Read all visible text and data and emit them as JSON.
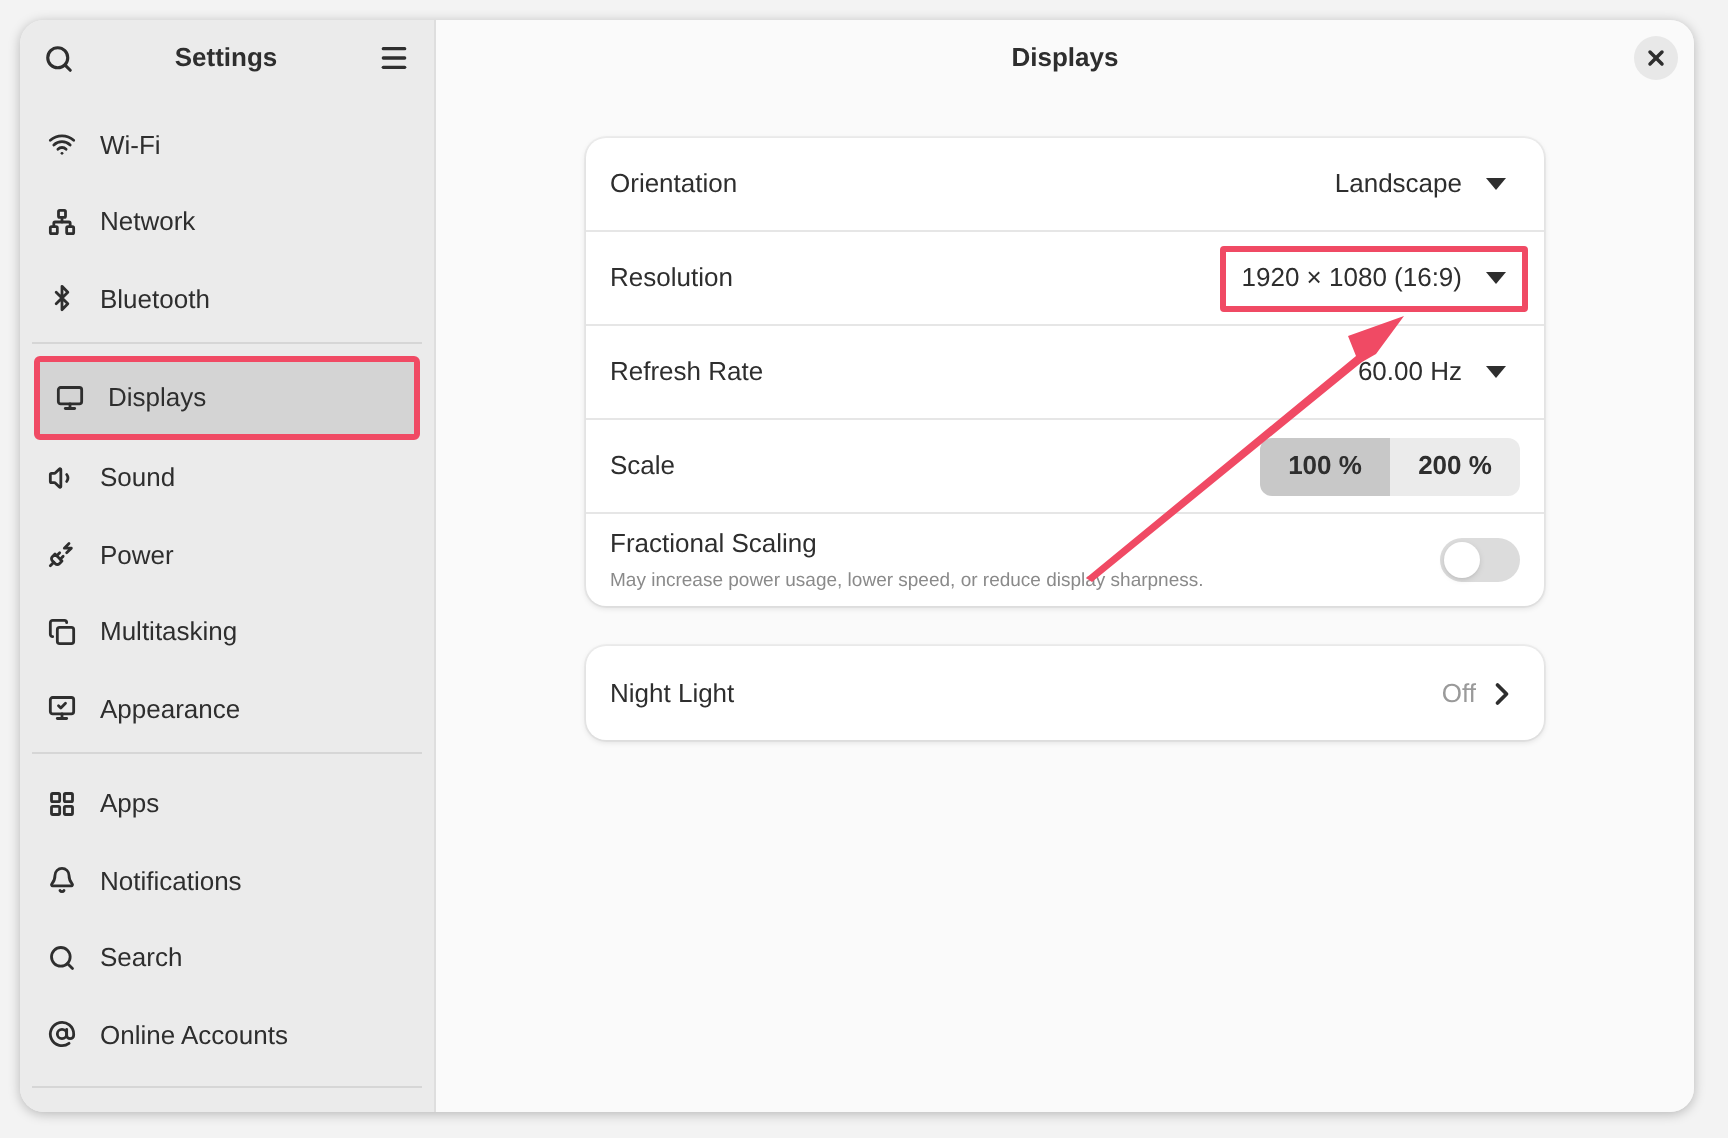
{
  "sidebar": {
    "title": "Settings",
    "sections": [
      {
        "items": [
          {
            "label": "Wi-Fi",
            "selected": false,
            "highlighted": false
          },
          {
            "label": "Network",
            "selected": false,
            "highlighted": false
          },
          {
            "label": "Bluetooth",
            "selected": false,
            "highlighted": false
          }
        ]
      },
      {
        "items": [
          {
            "label": "Displays",
            "selected": true,
            "highlighted": true
          },
          {
            "label": "Sound",
            "selected": false,
            "highlighted": false
          },
          {
            "label": "Power",
            "selected": false,
            "highlighted": false
          },
          {
            "label": "Multitasking",
            "selected": false,
            "highlighted": false
          },
          {
            "label": "Appearance",
            "selected": false,
            "highlighted": false
          }
        ]
      },
      {
        "items": [
          {
            "label": "Apps",
            "selected": false,
            "highlighted": false
          },
          {
            "label": "Notifications",
            "selected": false,
            "highlighted": false
          },
          {
            "label": "Search",
            "selected": false,
            "highlighted": false
          },
          {
            "label": "Online Accounts",
            "selected": false,
            "highlighted": false
          }
        ]
      }
    ]
  },
  "page": {
    "title": "Displays",
    "cards": [
      {
        "rows": [
          {
            "kind": "dropdown",
            "label": "Orientation",
            "value": "Landscape",
            "highlighted": false
          },
          {
            "kind": "dropdown",
            "label": "Resolution",
            "value": "1920 × 1080 (16:9)",
            "highlighted": true
          },
          {
            "kind": "dropdown",
            "label": "Refresh Rate",
            "value": "60.00 Hz",
            "highlighted": false
          },
          {
            "kind": "toggle-group",
            "label": "Scale",
            "options": [
              {
                "label": "100 %",
                "selected": true
              },
              {
                "label": "200 %",
                "selected": false
              }
            ]
          },
          {
            "kind": "switch",
            "label": "Fractional Scaling",
            "subtitle": "May increase power usage, lower speed, or reduce display sharpness.",
            "on": false
          }
        ]
      },
      {
        "rows": [
          {
            "kind": "link",
            "label": "Night Light",
            "value": "Off"
          }
        ]
      }
    ]
  }
}
